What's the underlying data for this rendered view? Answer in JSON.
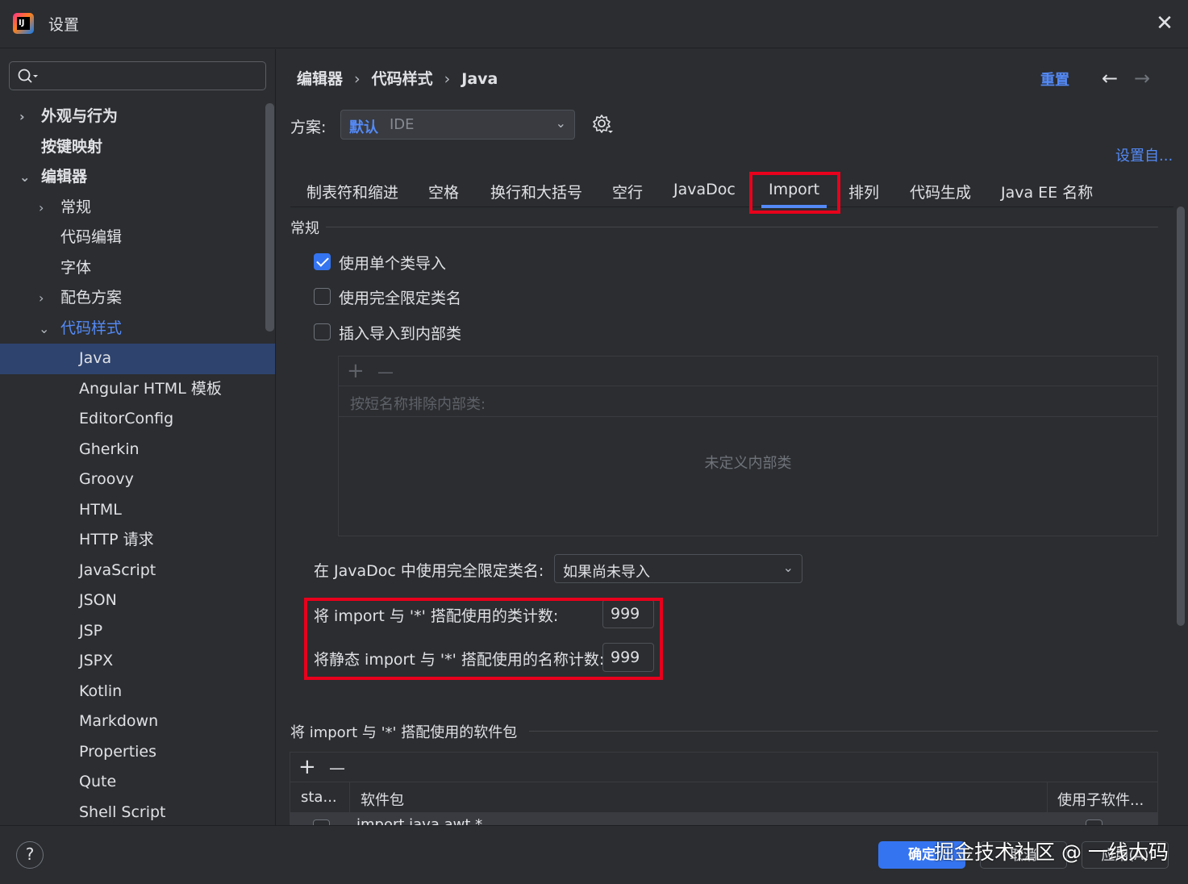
{
  "window": {
    "title": "设置",
    "close_glyph": "✕"
  },
  "search": {
    "placeholder": ""
  },
  "tree": [
    {
      "label": "外观与行为",
      "level": 0,
      "arrow": "›",
      "bold": true
    },
    {
      "label": "按键映射",
      "level": 0,
      "arrow": "",
      "bold": true
    },
    {
      "label": "编辑器",
      "level": 0,
      "arrow": "⌄",
      "bold": true
    },
    {
      "label": "常规",
      "level": 1,
      "arrow": "›"
    },
    {
      "label": "代码编辑",
      "level": 1,
      "arrow": ""
    },
    {
      "label": "字体",
      "level": 1,
      "arrow": ""
    },
    {
      "label": "配色方案",
      "level": 1,
      "arrow": "›"
    },
    {
      "label": "代码样式",
      "level": 1,
      "arrow": "⌄",
      "blue": true
    },
    {
      "label": "Java",
      "level": 2,
      "arrow": "",
      "selected": true
    },
    {
      "label": "Angular HTML 模板",
      "level": 2,
      "arrow": ""
    },
    {
      "label": "EditorConfig",
      "level": 2,
      "arrow": ""
    },
    {
      "label": "Gherkin",
      "level": 2,
      "arrow": ""
    },
    {
      "label": "Groovy",
      "level": 2,
      "arrow": ""
    },
    {
      "label": "HTML",
      "level": 2,
      "arrow": ""
    },
    {
      "label": "HTTP 请求",
      "level": 2,
      "arrow": ""
    },
    {
      "label": "JavaScript",
      "level": 2,
      "arrow": ""
    },
    {
      "label": "JSON",
      "level": 2,
      "arrow": ""
    },
    {
      "label": "JSP",
      "level": 2,
      "arrow": ""
    },
    {
      "label": "JSPX",
      "level": 2,
      "arrow": ""
    },
    {
      "label": "Kotlin",
      "level": 2,
      "arrow": ""
    },
    {
      "label": "Markdown",
      "level": 2,
      "arrow": ""
    },
    {
      "label": "Properties",
      "level": 2,
      "arrow": ""
    },
    {
      "label": "Qute",
      "level": 2,
      "arrow": ""
    },
    {
      "label": "Shell Script",
      "level": 2,
      "arrow": ""
    }
  ],
  "breadcrumb": {
    "part1": "编辑器",
    "part2": "代码样式",
    "part3": "Java",
    "sep": "›"
  },
  "header": {
    "reset": "重置",
    "back": "←",
    "forward": "→"
  },
  "scheme": {
    "label": "方案:",
    "value_primary": "默认",
    "value_secondary": "IDE"
  },
  "set_from": "设置自...",
  "tabs": [
    "制表符和缩进",
    "空格",
    "换行和大括号",
    "空行",
    "JavaDoc",
    "Import",
    "排列",
    "代码生成",
    "Java EE 名称"
  ],
  "general": {
    "title": "常规",
    "options": [
      {
        "label": "使用单个类导入",
        "checked": true
      },
      {
        "label": "使用完全限定类名",
        "checked": false
      },
      {
        "label": "插入导入到内部类",
        "checked": false
      }
    ]
  },
  "inner_classes": {
    "add": "+",
    "remove": "—",
    "header": "按短名称排除内部类:",
    "empty_text": "未定义内部类"
  },
  "javadoc": {
    "label": "在 JavaDoc 中使用完全限定类名:",
    "value": "如果尚未导入"
  },
  "counts": {
    "class_label": "将 import 与 '*' 搭配使用的类计数:",
    "class_value": "999",
    "static_label": "将静态 import 与 '*' 搭配使用的名称计数:",
    "static_value": "999"
  },
  "packages": {
    "title": "将 import 与 '*' 搭配使用的软件包",
    "add": "+",
    "remove": "—",
    "col_static": "sta...",
    "col_package": "软件包",
    "col_subpackages": "使用子软件...",
    "row_package": "import java.awt.*"
  },
  "footer": {
    "help": "?",
    "ok": "确定",
    "cancel": "取消",
    "apply": "应用(A)",
    "watermark": "掘金技术社区 @ 一线大码"
  },
  "colors": {
    "accent": "#548af7",
    "selected_bg": "#2e436e",
    "highlight_box": "#e8001c",
    "bg": "#2b2d30"
  }
}
